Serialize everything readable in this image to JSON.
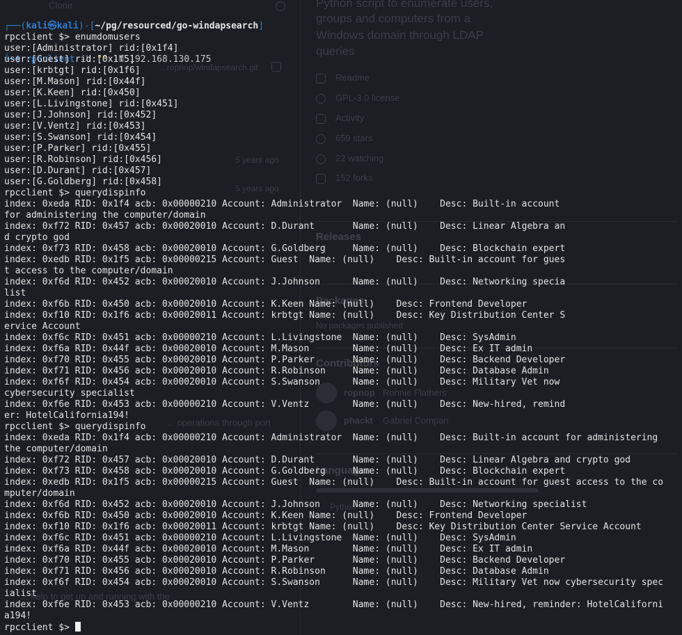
{
  "background_page": {
    "clone_label": "Clone",
    "about": [
      "Python script to enumerate users,",
      "groups and computers from a",
      "Windows domain through LDAP",
      "queries"
    ],
    "repo_link": "...ropnop/windapsearch.git",
    "about_items": [
      "Readme",
      "GPL-3.0 license",
      "Activity",
      "659 stars",
      "22 watching",
      "152 forks"
    ],
    "commit_ages": [
      "5 years ago",
      "5 years ago"
    ],
    "releases_heading": "Releases",
    "packages_heading": "Packages",
    "packages_note": "No packages published",
    "contributors_heading": "Contributors",
    "contributors": [
      {
        "handle": "ropnop",
        "name": "Ronnie Flathers"
      },
      {
        "handle": "phackt",
        "name": "Gabriel Compan"
      }
    ],
    "languages_heading": "Languages",
    "language": "Python",
    "readme_fragments": [
      "... operations through port",
      "... help to get up and running with the"
    ]
  },
  "terminal": {
    "prompt_user": "kali",
    "prompt_host": "kali",
    "prompt_at": "㉿",
    "cwd": "~/pg/resourced/go-windapsearch",
    "prompt_symbol": "$",
    "first_command": {
      "program": "rpcclient",
      "flag_user": "-U",
      "empty_user": "\"\"",
      "flag_nopass": "-N",
      "target": "192.168.130.175"
    },
    "rpc_prompt": "rpcclient $> ",
    "lines": [
      "enumdomusers",
      "user:[Administrator] rid:[0x1f4]",
      "user:[Guest] rid:[0x1f5]",
      "user:[krbtgt] rid:[0x1f6]",
      "user:[M.Mason] rid:[0x44f]",
      "user:[K.Keen] rid:[0x450]",
      "user:[L.Livingstone] rid:[0x451]",
      "user:[J.Johnson] rid:[0x452]",
      "user:[V.Ventz] rid:[0x453]",
      "user:[S.Swanson] rid:[0x454]",
      "user:[P.Parker] rid:[0x455]",
      "user:[R.Robinson] rid:[0x456]",
      "user:[D.Durant] rid:[0x457]",
      "user:[G.Goldberg] rid:[0x458]",
      "rpcclient $> querydispinfo",
      "index: 0xeda RID: 0x1f4 acb: 0x00000210 Account: Administrator  Name: (null)    Desc: Built-in account",
      "for administering the computer/domain",
      "index: 0xf72 RID: 0x457 acb: 0x00020010 Account: D.Durant       Name: (null)    Desc: Linear Algebra an",
      "d crypto god",
      "index: 0xf73 RID: 0x458 acb: 0x00020010 Account: G.Goldberg     Name: (null)    Desc: Blockchain expert",
      "index: 0xedb RID: 0x1f5 acb: 0x00000215 Account: Guest  Name: (null)    Desc: Built-in account for gues",
      "t access to the computer/domain",
      "index: 0xf6d RID: 0x452 acb: 0x00020010 Account: J.Johnson      Name: (null)    Desc: Networking specia",
      "list",
      "index: 0xf6b RID: 0x450 acb: 0x00020010 Account: K.Keen Name: (null)    Desc: Frontend Developer",
      "index: 0xf10 RID: 0x1f6 acb: 0x00020011 Account: krbtgt Name: (null)    Desc: Key Distribution Center S",
      "ervice Account",
      "index: 0xf6c RID: 0x451 acb: 0x00000210 Account: L.Livingstone  Name: (null)    Desc: SysAdmin",
      "index: 0xf6a RID: 0x44f acb: 0x00020010 Account: M.Mason        Name: (null)    Desc: Ex IT admin",
      "index: 0xf70 RID: 0x455 acb: 0x00020010 Account: P.Parker       Name: (null)    Desc: Backend Developer",
      "index: 0xf71 RID: 0x456 acb: 0x00020010 Account: R.Robinson     Name: (null)    Desc: Database Admin",
      "index: 0xf6f RID: 0x454 acb: 0x00020010 Account: S.Swanson      Name: (null)    Desc: Military Vet now",
      "cybersecurity specialist",
      "index: 0xf6e RID: 0x453 acb: 0x00000210 Account: V.Ventz        Name: (null)    Desc: New-hired, remind",
      "er: HotelCalifornia194!",
      "rpcclient $> querydispinfo",
      "index: 0xeda RID: 0x1f4 acb: 0x00000210 Account: Administrator  Name: (null)    Desc: Built-in account for administering",
      "the computer/domain",
      "index: 0xf72 RID: 0x457 acb: 0x00020010 Account: D.Durant       Name: (null)    Desc: Linear Algebra and crypto god",
      "index: 0xf73 RID: 0x458 acb: 0x00020010 Account: G.Goldberg     Name: (null)    Desc: Blockchain expert",
      "index: 0xedb RID: 0x1f5 acb: 0x00000215 Account: Guest  Name: (null)    Desc: Built-in account for guest access to the co",
      "mputer/domain",
      "index: 0xf6d RID: 0x452 acb: 0x00020010 Account: J.Johnson      Name: (null)    Desc: Networking specialist",
      "index: 0xf6b RID: 0x450 acb: 0x00020010 Account: K.Keen Name: (null)    Desc: Frontend Developer",
      "index: 0xf10 RID: 0x1f6 acb: 0x00020011 Account: krbtgt Name: (null)    Desc: Key Distribution Center Service Account",
      "index: 0xf6c RID: 0x451 acb: 0x00000210 Account: L.Livingstone  Name: (null)    Desc: SysAdmin",
      "index: 0xf6a RID: 0x44f acb: 0x00020010 Account: M.Mason        Name: (null)    Desc: Ex IT admin",
      "index: 0xf70 RID: 0x455 acb: 0x00020010 Account: P.Parker       Name: (null)    Desc: Backend Developer",
      "index: 0xf71 RID: 0x456 acb: 0x00020010 Account: R.Robinson     Name: (null)    Desc: Database Admin",
      "index: 0xf6f RID: 0x454 acb: 0x00020010 Account: S.Swanson      Name: (null)    Desc: Military Vet now cybersecurity spec",
      "ialist",
      "index: 0xf6e RID: 0x453 acb: 0x00000210 Account: V.Ventz        Name: (null)    Desc: New-hired, reminder: HotelCaliforni",
      "a194!"
    ]
  }
}
